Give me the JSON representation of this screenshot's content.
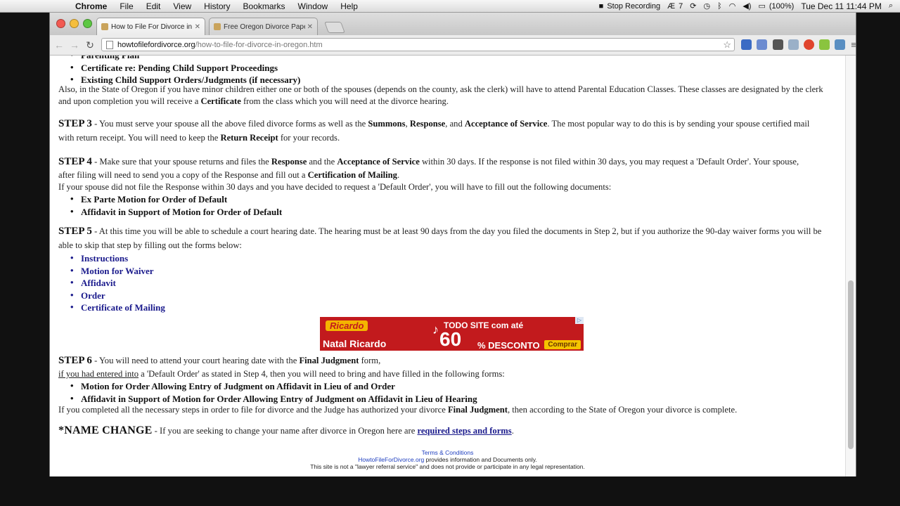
{
  "menubar": {
    "app": "Chrome",
    "items": [
      "File",
      "Edit",
      "View",
      "History",
      "Bookmarks",
      "Window",
      "Help"
    ],
    "stop_recording": "Stop Recording",
    "status_num": "7",
    "battery": "(100%)",
    "datetime": "Tue Dec 11  11:44 PM"
  },
  "tabs": [
    {
      "title": "How to File For Divorce in Or",
      "active": true
    },
    {
      "title": "Free Oregon Divorce Papers",
      "active": false
    }
  ],
  "toolbar": {
    "url_domain": "howtofilefordivorce.org",
    "url_path": "/how-to-file-for-divorce-in-oregon.htm"
  },
  "content": {
    "top_list": [
      "Parenting Plan",
      "Certificate re: Pending Child Support Proceedings",
      "Existing Child Support Orders/Judgments (if necessary)"
    ],
    "oregon_para": {
      "l1": "Also, in the State of Oregon if you have minor children either one or both of the spouses (depends on the county, ask the clerk) will have to attend Parental Education Classes. These classes are designated by the clerk",
      "l2a": "and upon completion you will receive a ",
      "l2b": "Certificate",
      "l2c": " from the class which you will need at the divorce hearing."
    },
    "step3": {
      "label": "STEP 3",
      "a": " - You must serve your spouse all the above filed divorce forms as well as the ",
      "b1": "Summons",
      "c1": ", ",
      "b2": "Response",
      "c2": ", and ",
      "b3": "Acceptance of Service",
      "d": ". The most popular way to do this is by sending your spouse certified mail",
      "l2a": "with return receipt. You will need to keep the ",
      "l2b": "Return Receipt",
      "l2c": " for your records."
    },
    "step4": {
      "label": "STEP 4",
      "a": " - Make sure that your spouse returns and files the ",
      "b1": "Response",
      "c1": " and the ",
      "b2": "Acceptance of Service",
      "d": " within 30 days. If the response is not filed within 30 days, you may request a 'Default Order'. Your spouse,",
      "l2a": "after filing will need to send you a copy of the Response and fill out a ",
      "l2b": "Certification of Mailing",
      "l2c": ".",
      "l3": "If your spouse did not file the Response within 30 days and you have decided to request a 'Default Order', you will have to fill out the following documents:",
      "list": [
        "Ex Parte Motion for Order of Default",
        "Affidavit in Support of Motion for Order of Default"
      ]
    },
    "step5": {
      "label": "STEP 5",
      "a": " - At this time you will be able to schedule a court hearing date. The hearing must be at least 90 days from the day you filed the documents in Step 2, but if you authorize the 90-day waiver forms you will be",
      "l2": "able to skip that step by filling out the forms below:",
      "links": [
        "Instructions",
        "Motion for Waiver",
        "Affidavit",
        "Order",
        "Certificate of Mailing"
      ]
    },
    "ad": {
      "logo": "Ricardo",
      "natal": "Natal Ricardo",
      "todo": "TODO SITE com até",
      "pct": "60",
      "desc": "% DESCONTO",
      "button": "Comprar"
    },
    "step6": {
      "label": "STEP 6",
      "a": " - You will need to attend your court hearing date with the ",
      "b": "Final Judgment",
      "c": " form,",
      "l2u": "if you had entered into",
      "l2": " a 'Default Order' as stated in Step 4, then you will need to bring and have filled in the following forms:",
      "list": [
        "Motion for Order Allowing Entry of Judgment on Affidavit in Lieu of and Order",
        "Affidavit in Support of Motion for Order Allowing Entry of Judgment on Affidavit in Lieu of Hearing"
      ],
      "l5a": "If you completed all the necessary steps in order to file for divorce and the Judge has authorized your divorce ",
      "l5b": "Final Judgment",
      "l5c": ", then according to the State of Oregon your divorce is complete."
    },
    "name_change": {
      "label": "*NAME CHANGE",
      "a": " - If you are seeking to change your name after divorce in Oregon here are ",
      "link": "required steps and forms",
      "b": "."
    }
  },
  "footer": {
    "terms": "Terms & Conditions",
    "site": "HowtoFileForDivorce.org",
    "site_rest": " provides information and Documents only.",
    "disclaimer": "This site is not a \"lawyer referral service\" and does not provide or participate in any legal representation."
  }
}
